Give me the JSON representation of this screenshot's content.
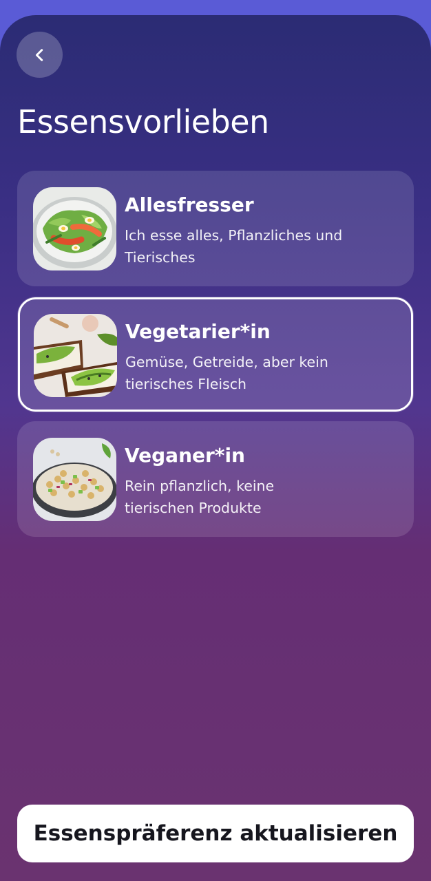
{
  "header": {
    "back_icon": "chevron-left-icon",
    "title": "Essensvorlieben"
  },
  "options": [
    {
      "title": "Allesfresser",
      "description": "Ich esse alles, Pflanzliches und Tierisches",
      "image": "salad-with-salmon-and-eggs",
      "selected": false
    },
    {
      "title": "Vegetarier*in",
      "description": "Gemüse, Getreide, aber kein tierisches Fleisch",
      "image": "avocado-toast",
      "selected": true
    },
    {
      "title": "Veganer*in",
      "description": "Rein pflanzlich, keine tierischen Produkte",
      "image": "chickpea-salad",
      "selected": false
    }
  ],
  "footer": {
    "update_label": "Essenspräferenz aktualisieren"
  },
  "colors": {
    "top_bar": "#5a5bd6",
    "gradient_top": "#2b2c74",
    "gradient_bottom": "#6a3370",
    "button_bg": "#ffffff",
    "button_text": "#16161e"
  }
}
